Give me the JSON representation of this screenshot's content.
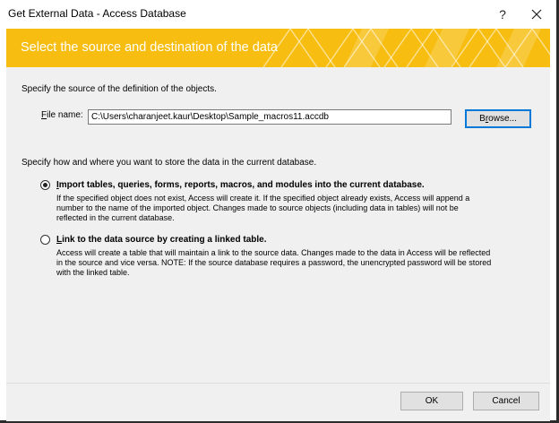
{
  "window": {
    "title": "Get External Data - Access Database",
    "help_label": "?",
    "close_icon": "close-icon"
  },
  "banner": {
    "heading": "Select the source and destination of the data",
    "color": "#f7bd10"
  },
  "source": {
    "heading": "Specify the source of the definition of the objects.",
    "file_label_accel": "F",
    "file_label_rest": "ile name:",
    "file_value": "C:\\Users\\charanjeet.kaur\\Desktop\\Sample_macros11.accdb",
    "browse_accel": "r",
    "browse_pre": "B",
    "browse_post": "owse..."
  },
  "destination": {
    "heading": "Specify how and where you want to store the data in the current database.",
    "options": [
      {
        "selected": true,
        "accel": "I",
        "title_rest": "mport tables, queries, forms, reports, macros, and modules into the current database.",
        "description": "If the specified object does not exist, Access will create it. If the specified object already exists, Access will append a\nnumber to the name of the imported object. Changes made to source objects (including data in tables) will not be\nreflected in the current database."
      },
      {
        "selected": false,
        "accel": "L",
        "title_rest": "ink to the data source by creating a linked table.",
        "description": "Access will create a table that will maintain a link to the source data. Changes made to the data in Access will be reflected\nin the source and vice versa. NOTE:  If the source database requires a password, the unencrypted password will be stored\nwith the linked table."
      }
    ]
  },
  "footer": {
    "ok_label": "OK",
    "cancel_label": "Cancel"
  }
}
